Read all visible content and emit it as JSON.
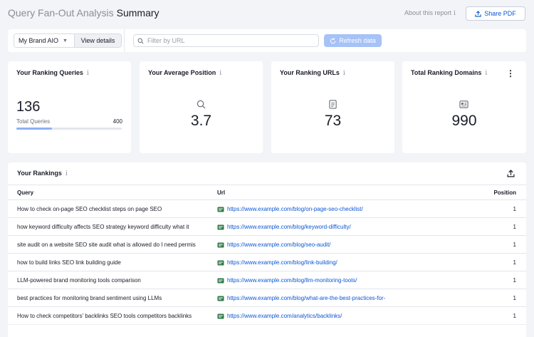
{
  "header": {
    "title_muted": "Query Fan-Out Analysis",
    "title_main": "Summary",
    "about_label": "About this report",
    "share_label": "Share PDF"
  },
  "filters": {
    "brand_select": "My Brand AIO",
    "view_details": "View details",
    "search_placeholder": "Filter by URL",
    "refresh_label": "Refresh data"
  },
  "cards": {
    "queries": {
      "title": "Your Ranking Queries",
      "value": "136",
      "sub_label": "Total Queries",
      "sub_value": "400",
      "progress": 0.34
    },
    "position": {
      "title": "Your Average Position",
      "value": "3.7"
    },
    "urls": {
      "title": "Your Ranking URLs",
      "value": "73"
    },
    "domains": {
      "title": "Total Ranking Domains",
      "value": "990"
    }
  },
  "rankings": {
    "title": "Your Rankings",
    "columns": {
      "query": "Query",
      "url": "Url",
      "position": "Position"
    },
    "rows": [
      {
        "query": "How to check on-page SEO checklist steps on page SEO",
        "url": "https://www.example.com/blog/on-page-seo-checklist/",
        "position": "1"
      },
      {
        "query": "how keyword difficulty affects SEO strategy keyword difficulty what it",
        "url": "https://www.example.com/blog/keyword-difficulty/",
        "position": "1"
      },
      {
        "query": "site audit on a website SEO site audit what is allowed do I need permis",
        "url": "https://www.example.com/blog/seo-audit/",
        "position": "1"
      },
      {
        "query": "how to build links SEO link building guide",
        "url": "https://www.example.com/blog/link-building/",
        "position": "1"
      },
      {
        "query": "LLM-powered brand monitoring tools comparison",
        "url": "https://www.example.com/blog/llm-monitoring-tools/",
        "position": "1"
      },
      {
        "query": "best practices for monitoring brand sentiment using LLMs",
        "url": "https://www.example.com/blog/what-are-the-best-practices-for-",
        "position": "1"
      },
      {
        "query": "How to check competitors' backlinks SEO tools competitors backlinks",
        "url": "https://www.example.com/analytics/backlinks/",
        "position": "1"
      }
    ]
  }
}
